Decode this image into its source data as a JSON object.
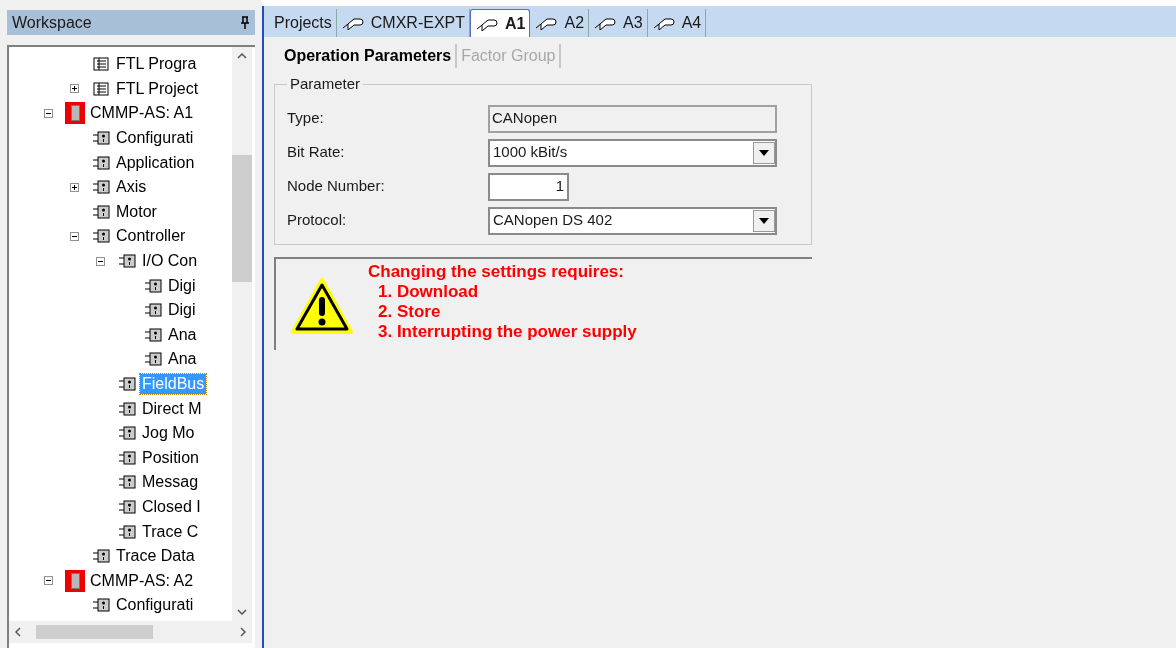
{
  "workspace": {
    "title": "Workspace"
  },
  "tree": [
    {
      "label": "FTL Progra",
      "kind": "file"
    },
    {
      "label": "FTL Project",
      "kind": "file",
      "expanded": false
    }
  ],
  "devices": [
    {
      "label": "CMMP-AS: A1",
      "kind": "device",
      "expanded": true,
      "children": [
        {
          "label": "Configurati",
          "kind": "item"
        },
        {
          "label": "Application",
          "kind": "item"
        },
        {
          "label": "Axis",
          "kind": "item",
          "expanded": false
        },
        {
          "label": "Motor",
          "kind": "item"
        },
        {
          "label": "Controller",
          "kind": "item",
          "expanded": true,
          "children": [
            {
              "label": "I/O Con",
              "kind": "item",
              "expanded": true,
              "children": [
                {
                  "label": "Digi",
                  "kind": "item"
                },
                {
                  "label": "Digi",
                  "kind": "item"
                },
                {
                  "label": "Ana",
                  "kind": "item"
                },
                {
                  "label": "Ana",
                  "kind": "item"
                }
              ]
            },
            {
              "label": "FieldBus",
              "kind": "item",
              "selected": true
            },
            {
              "label": "Direct M",
              "kind": "item"
            },
            {
              "label": "Jog Mo",
              "kind": "item"
            },
            {
              "label": "Position",
              "kind": "item"
            },
            {
              "label": "Messag",
              "kind": "item"
            },
            {
              "label": "Closed I",
              "kind": "item"
            },
            {
              "label": "Trace C",
              "kind": "item"
            }
          ]
        },
        {
          "label": "Trace Data",
          "kind": "item"
        }
      ]
    },
    {
      "label": "CMMP-AS: A2",
      "kind": "device",
      "expanded": true,
      "children": [
        {
          "label": "Configurati",
          "kind": "item"
        }
      ]
    }
  ],
  "tabs": [
    {
      "label": "Projects",
      "selected": false,
      "icon": false
    },
    {
      "label": "CMXR-EXPT",
      "selected": false,
      "icon": true
    },
    {
      "label": "A1",
      "selected": true,
      "icon": true
    },
    {
      "label": "A2",
      "selected": false,
      "icon": true
    },
    {
      "label": "A3",
      "selected": false,
      "icon": true
    },
    {
      "label": "A4",
      "selected": false,
      "icon": true
    }
  ],
  "subtabs": [
    {
      "label": "Operation Parameters",
      "selected": true
    },
    {
      "label": "Factor Group",
      "selected": false
    }
  ],
  "group": {
    "title": "Parameter",
    "fields": [
      {
        "label": "Type:",
        "kind": "readonly",
        "value": "CANopen"
      },
      {
        "label": "Bit Rate:",
        "kind": "dropdown",
        "value": "1000 kBit/s"
      },
      {
        "label": "Node Number:",
        "kind": "number",
        "value": "1"
      },
      {
        "label": "Protocol:",
        "kind": "dropdown",
        "value": "CANopen DS 402"
      }
    ]
  },
  "warning": {
    "heading": "Changing the settings requires:",
    "steps": [
      "1. Download",
      "2. Store",
      "3. Interrupting the power supply"
    ]
  }
}
